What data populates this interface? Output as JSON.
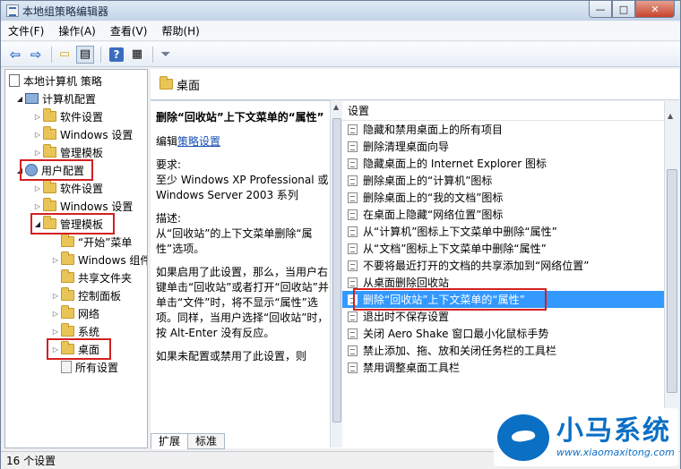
{
  "window": {
    "title": "本地组策略编辑器",
    "min": "—",
    "max": "□",
    "close": "✕"
  },
  "menu": [
    "文件(F)",
    "操作(A)",
    "查看(V)",
    "帮助(H)"
  ],
  "toolbar": {
    "back": "⇦",
    "forward": "⇨",
    "up": "▭",
    "show": "▤",
    "help": "?",
    "export": "▦",
    "filter": "⏷"
  },
  "tree": [
    {
      "label": "本地计算机 策略",
      "icon": "policy-icon",
      "level": 0,
      "arrow": ""
    },
    {
      "label": "计算机配置",
      "icon": "computer-icon",
      "level": 1,
      "arrow": "◢"
    },
    {
      "label": "软件设置",
      "icon": "folder-icon",
      "level": 2,
      "arrow": "▷"
    },
    {
      "label": "Windows 设置",
      "icon": "folder-icon",
      "level": 2,
      "arrow": "▷"
    },
    {
      "label": "管理模板",
      "icon": "folder-icon",
      "level": 2,
      "arrow": "▷"
    },
    {
      "label": "用户配置",
      "icon": "users-icon",
      "level": 1,
      "arrow": "◢"
    },
    {
      "label": "软件设置",
      "icon": "folder-icon",
      "level": 2,
      "arrow": "▷"
    },
    {
      "label": "Windows 设置",
      "icon": "folder-icon",
      "level": 2,
      "arrow": "▷"
    },
    {
      "label": "管理模板",
      "icon": "folder-icon",
      "level": 2,
      "arrow": "◢"
    },
    {
      "label": "“开始”菜单",
      "icon": "folder-icon",
      "level": 3,
      "arrow": ""
    },
    {
      "label": "Windows 组件",
      "icon": "folder-icon",
      "level": 3,
      "arrow": "▷"
    },
    {
      "label": "共享文件夹",
      "icon": "folder-icon",
      "level": 3,
      "arrow": ""
    },
    {
      "label": "控制面板",
      "icon": "folder-icon",
      "level": 3,
      "arrow": "▷"
    },
    {
      "label": "网络",
      "icon": "folder-icon",
      "level": 3,
      "arrow": "▷"
    },
    {
      "label": "系统",
      "icon": "folder-icon",
      "level": 3,
      "arrow": "▷"
    },
    {
      "label": "桌面",
      "icon": "folder-icon",
      "level": 3,
      "arrow": "▷"
    },
    {
      "label": "所有设置",
      "icon": "settings-icon",
      "level": 3,
      "arrow": ""
    }
  ],
  "header": {
    "title": "桌面"
  },
  "description": {
    "title": "删除“回收站”上下文菜单的“属性”",
    "edit_prefix": "编辑",
    "edit_link": "策略设置",
    "req_label": "要求:",
    "req_text": "至少 Windows XP Professional 或 Windows Server 2003 系列",
    "desc_label": "描述:",
    "desc_text": "从“回收站”的上下文菜单删除“属性”选项。",
    "para1": "如果启用了此设置，那么，当用户右键单击“回收站”或者打开“回收站”并单击“文件”时，将不显示“属性”选项。同样，当用户选择“回收站”时，按 Alt-Enter 没有反应。",
    "para2": "如果未配置或禁用了此设置，则"
  },
  "list": {
    "header": "设置",
    "items": [
      "隐藏和禁用桌面上的所有项目",
      "删除清理桌面向导",
      "隐藏桌面上的 Internet Explorer 图标",
      "删除桌面上的“计算机”图标",
      "删除桌面上的“我的文档”图标",
      "在桌面上隐藏“网络位置”图标",
      "从“计算机”图标上下文菜单中删除“属性”",
      "从“文档”图标上下文菜单中删除“属性”",
      "不要将最近打开的文档的共享添加到“网络位置”",
      "从桌面删除回收站",
      "删除“回收站”上下文菜单的“属性”",
      "退出时不保存设置",
      "关闭 Aero Shake 窗口最小化鼠标手势",
      "禁止添加、拖、放和关闭任务栏的工具栏",
      "禁用调整桌面工具栏"
    ],
    "selected_index": 10
  },
  "tabs": [
    "扩展",
    "标准"
  ],
  "status": {
    "text": "16 个设置"
  },
  "watermark": {
    "name": "小马系统",
    "url": "www.xiaomaxitong.com"
  },
  "colors": {
    "selection": "#3399ff",
    "highlight_box": "#d32020",
    "link": "#1a4fb5"
  }
}
